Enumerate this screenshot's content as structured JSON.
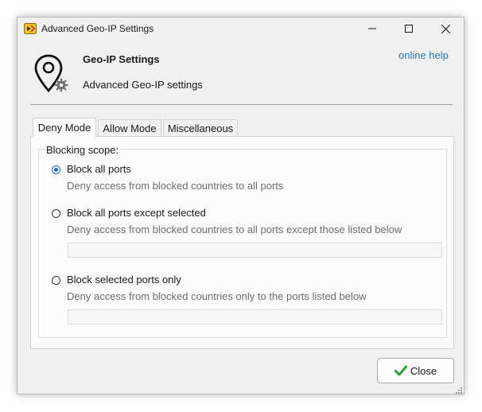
{
  "window": {
    "title": "Advanced Geo-IP Settings"
  },
  "header": {
    "title": "Geo-IP Settings",
    "subtitle": "Advanced Geo-IP settings",
    "online_help": "online help"
  },
  "tabs": [
    {
      "label": "Deny Mode",
      "active": true
    },
    {
      "label": "Allow Mode",
      "active": false
    },
    {
      "label": "Miscellaneous",
      "active": false
    }
  ],
  "blocking": {
    "group_label": "Blocking scope:",
    "options": [
      {
        "label": "Block all ports",
        "description": "Deny access from blocked countries to all ports",
        "checked": true
      },
      {
        "label": "Block all ports except selected",
        "description": "Deny access from blocked countries to all ports except those listed below",
        "checked": false,
        "input_value": ""
      },
      {
        "label": "Block selected ports only",
        "description": "Deny access from blocked countries only to the ports listed below",
        "checked": false,
        "input_value": ""
      }
    ]
  },
  "footer": {
    "close_label": "Close"
  },
  "icons": {
    "app": "app-shield-icon",
    "header": "location-pin-gear-icon",
    "close_button": "checkmark-icon"
  },
  "colors": {
    "link": "#2e78b4",
    "radio_accent": "#1a6ad0",
    "checkmark": "#2a9a3a"
  }
}
